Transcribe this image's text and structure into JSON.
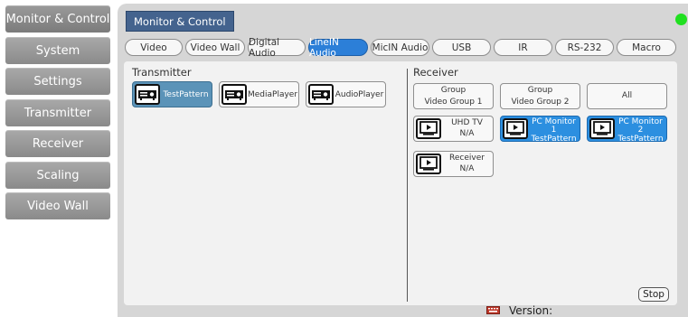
{
  "sidebar": {
    "items": [
      {
        "label": "Monitor & Control"
      },
      {
        "label": "System"
      },
      {
        "label": "Settings"
      },
      {
        "label": "Transmitter"
      },
      {
        "label": "Receiver"
      },
      {
        "label": "Scaling"
      },
      {
        "label": "Video Wall"
      }
    ],
    "active_index": 0
  },
  "header": {
    "title": "Monitor & Control",
    "status_color": "#20e020"
  },
  "tabs": [
    {
      "label": "Video"
    },
    {
      "label": "Video Wall"
    },
    {
      "label": "Digital Audio"
    },
    {
      "label": "LineIN Audio",
      "active": true
    },
    {
      "label": "MicIN Audio"
    },
    {
      "label": "USB"
    },
    {
      "label": "IR"
    },
    {
      "label": "RS-232"
    },
    {
      "label": "Macro"
    }
  ],
  "transmitter": {
    "title": "Transmitter",
    "devices": [
      {
        "name": "TestPattern",
        "icon": "projector-icon",
        "selected": true
      },
      {
        "name": "MediaPlayer",
        "icon": "projector-icon",
        "selected": false
      },
      {
        "name": "AudioPlayer",
        "icon": "projector-icon",
        "selected": false
      }
    ]
  },
  "receiver": {
    "title": "Receiver",
    "groups": [
      {
        "line1": "Group",
        "line2": "Video Group 1"
      },
      {
        "line1": "Group",
        "line2": "Video Group 2"
      },
      {
        "line1": "All",
        "line2": ""
      }
    ],
    "devices": [
      {
        "name": "UHD TV",
        "source": "N/A",
        "icon": "monitor-play-icon",
        "active": false
      },
      {
        "name": "PC Monitor 1",
        "source": "TestPattern",
        "icon": "monitor-play-icon",
        "active": true
      },
      {
        "name": "PC Monitor 2",
        "source": "TestPattern",
        "icon": "monitor-play-icon",
        "active": true
      },
      {
        "name": "Receiver",
        "source": "N/A",
        "icon": "monitor-play-icon",
        "active": false
      }
    ],
    "stop_label": "Stop"
  },
  "footer": {
    "version_label": "Version:",
    "keyboard_icon": "keyboard-icon",
    "keyboard_color": "#c0392b"
  },
  "colors": {
    "accent": "#2c7fd8",
    "sidebar_button": "#999999",
    "title_chip": "#44638e"
  }
}
